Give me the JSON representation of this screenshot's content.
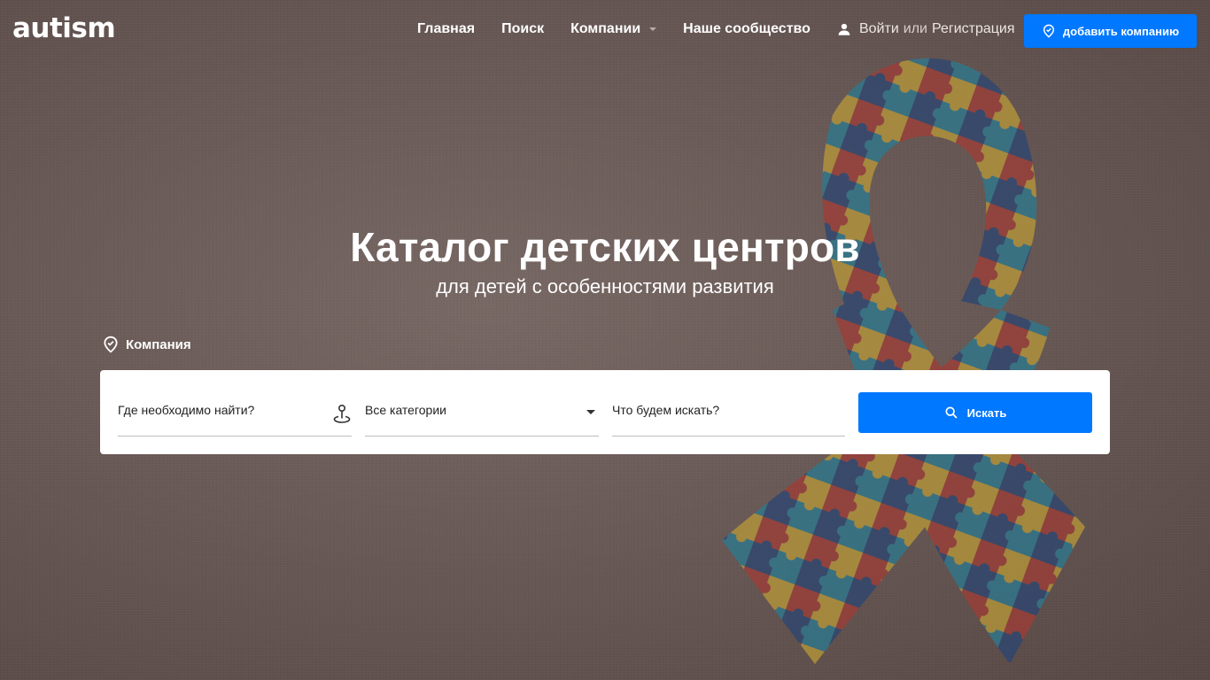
{
  "brand": {
    "logo": "autism"
  },
  "nav": {
    "items": [
      {
        "label": "Главная"
      },
      {
        "label": "Поиск"
      },
      {
        "label": "Компании"
      },
      {
        "label": "Наше сообщество"
      }
    ]
  },
  "auth": {
    "login": "Войти",
    "or": "или",
    "register": "Регистрация"
  },
  "add_company": {
    "label": "добавить компанию"
  },
  "hero": {
    "title": "Каталог детских центров",
    "subtitle": "для детей с особенностями развития"
  },
  "search": {
    "tab_label": "Компания",
    "where_placeholder": "Где необходимо найти?",
    "category_value": "Все категории",
    "what_placeholder": "Что будем искать?",
    "button_label": "Искать"
  },
  "colors": {
    "accent": "#0078ff",
    "white": "#ffffff"
  },
  "icons": [
    "user-icon",
    "location-check-icon",
    "pin-icon",
    "chevron-down-icon",
    "search-icon"
  ]
}
